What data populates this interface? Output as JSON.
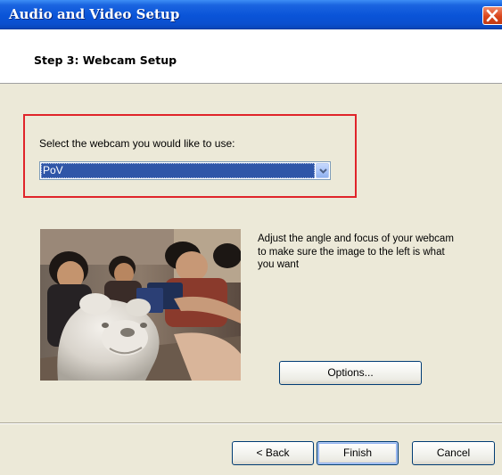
{
  "window": {
    "title": "Audio and Video Setup",
    "close_icon": "close-icon"
  },
  "header": {
    "title": "Step 3: Webcam Setup"
  },
  "webcam": {
    "prompt": "Select the webcam you would like to use:",
    "selected": "PoV",
    "dropdown_icon": "chevron-down-icon"
  },
  "preview": {
    "description": "Adjust the angle and focus of your webcam to make sure the image to the left is what you want"
  },
  "buttons": {
    "options": "Options...",
    "back": "< Back",
    "finish": "Finish",
    "cancel": "Cancel"
  },
  "colors": {
    "titlebar": "#0a54d8",
    "highlight_border": "#e0242a",
    "selection": "#2f56a8",
    "close_button": "#d9451c"
  }
}
